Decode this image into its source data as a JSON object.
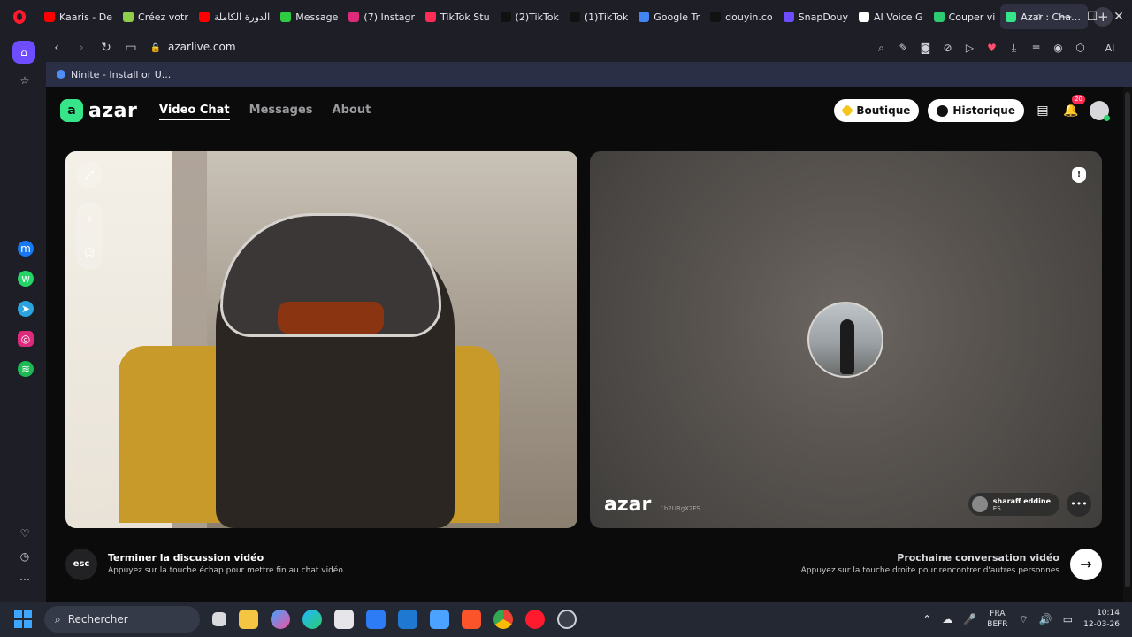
{
  "browser": {
    "tabs": [
      {
        "label": "Kaaris - De",
        "color": "#ff0000",
        "active": false
      },
      {
        "label": "Créez votr",
        "color": "#8fce4a",
        "active": false
      },
      {
        "label": "الدورة الكاملة",
        "color": "#ff0000",
        "active": false
      },
      {
        "label": "Message",
        "color": "#2ecc40",
        "active": false
      },
      {
        "label": "(7) Instagr",
        "color": "#dd2a7b",
        "active": false
      },
      {
        "label": "TikTok Stu",
        "color": "#ff2d55",
        "active": false
      },
      {
        "label": "(2)TikTok",
        "color": "#111111",
        "active": false
      },
      {
        "label": "(1)TikTok",
        "color": "#111111",
        "active": false
      },
      {
        "label": "Google Tr",
        "color": "#4285f4",
        "active": false
      },
      {
        "label": "douyin.co",
        "color": "#111111",
        "active": false
      },
      {
        "label": "SnapDouy",
        "color": "#6d4dff",
        "active": false
      },
      {
        "label": "AI Voice G",
        "color": "#ffffff",
        "active": false
      },
      {
        "label": "Couper vi",
        "color": "#2ecc71",
        "active": false
      },
      {
        "label": "Azar : Chat Vid",
        "color": "#36e58a",
        "active": true
      }
    ],
    "url": "azarlive.com",
    "ai_label": "AI",
    "bookmark": "Ninite - Install or U..."
  },
  "header": {
    "logo_mark": "a",
    "logo_text": "azar",
    "nav": [
      {
        "label": "Video Chat",
        "active": true
      },
      {
        "label": "Messages",
        "active": false
      },
      {
        "label": "About",
        "active": false
      }
    ],
    "boutique_label": "Boutique",
    "historique_label": "Historique",
    "notification_count": "20"
  },
  "video": {
    "watermark": "azar",
    "session_id": "1b2URgX2FS",
    "peer_name": "sharaff eddine",
    "peer_country": "ES"
  },
  "controls": {
    "esc_label": "esc",
    "end_title": "Terminer la discussion vidéo",
    "end_hint": "Appuyez sur la touche échap pour mettre fin au chat vidéo.",
    "next_title": "Prochaine conversation vidéo",
    "next_hint": "Appuyez sur la touche droite pour rencontrer d'autres personnes"
  },
  "taskbar": {
    "search_placeholder": "Rechercher",
    "lang_line1": "FRA",
    "lang_line2": "BEFR",
    "time": "10:14",
    "date": "12-03-26"
  },
  "colors": {
    "accent": "#36e58a",
    "opera_red": "#ff1b2d",
    "sidebar_active": "#6d4dff"
  }
}
